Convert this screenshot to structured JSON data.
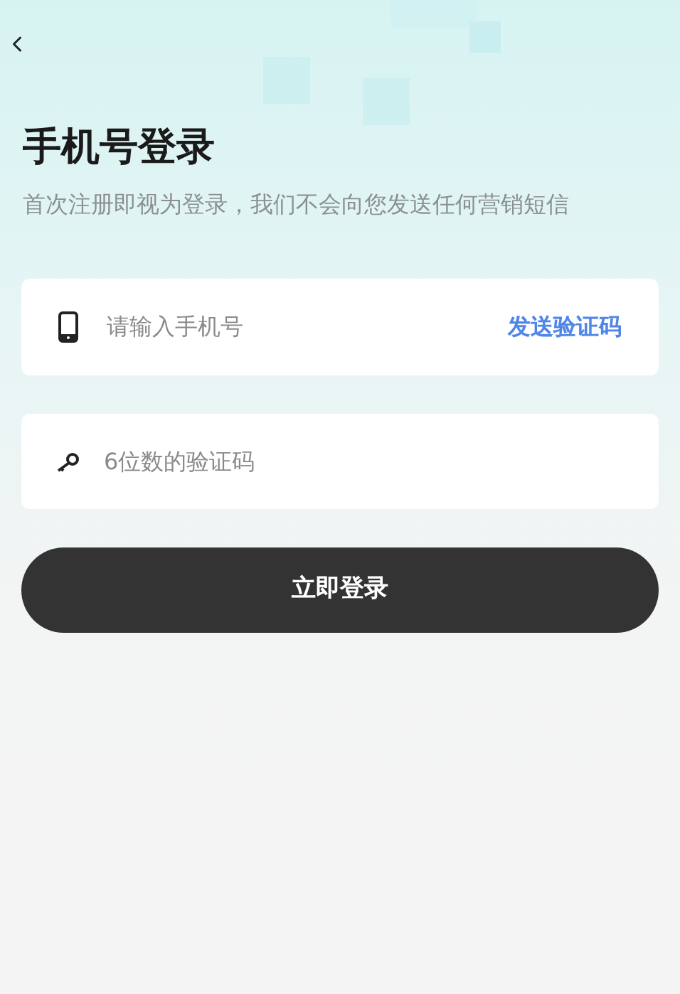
{
  "title": "手机号登录",
  "subtitle": "首次注册即视为登录，我们不会向您发送任何营销短信",
  "phone_field": {
    "placeholder": "请输入手机号",
    "action": "发送验证码"
  },
  "code_field": {
    "placeholder": "6位数的验证码"
  },
  "login_button": "立即登录"
}
